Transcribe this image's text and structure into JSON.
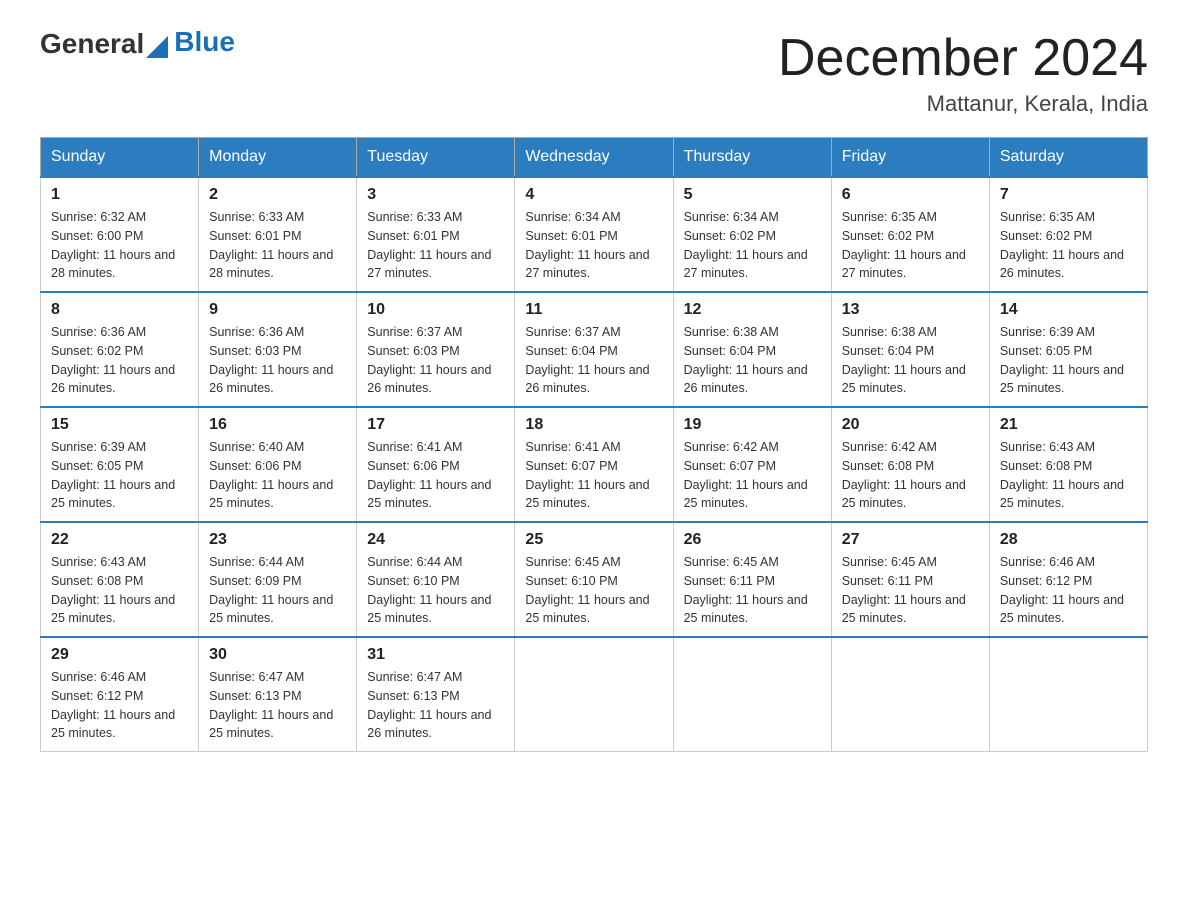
{
  "header": {
    "logo": {
      "general": "General",
      "blue": "Blue"
    },
    "title": "December 2024",
    "location": "Mattanur, Kerala, India"
  },
  "days_of_week": [
    "Sunday",
    "Monday",
    "Tuesday",
    "Wednesday",
    "Thursday",
    "Friday",
    "Saturday"
  ],
  "weeks": [
    [
      {
        "day": "1",
        "sunrise": "6:32 AM",
        "sunset": "6:00 PM",
        "daylight": "11 hours and 28 minutes."
      },
      {
        "day": "2",
        "sunrise": "6:33 AM",
        "sunset": "6:01 PM",
        "daylight": "11 hours and 28 minutes."
      },
      {
        "day": "3",
        "sunrise": "6:33 AM",
        "sunset": "6:01 PM",
        "daylight": "11 hours and 27 minutes."
      },
      {
        "day": "4",
        "sunrise": "6:34 AM",
        "sunset": "6:01 PM",
        "daylight": "11 hours and 27 minutes."
      },
      {
        "day": "5",
        "sunrise": "6:34 AM",
        "sunset": "6:02 PM",
        "daylight": "11 hours and 27 minutes."
      },
      {
        "day": "6",
        "sunrise": "6:35 AM",
        "sunset": "6:02 PM",
        "daylight": "11 hours and 27 minutes."
      },
      {
        "day": "7",
        "sunrise": "6:35 AM",
        "sunset": "6:02 PM",
        "daylight": "11 hours and 26 minutes."
      }
    ],
    [
      {
        "day": "8",
        "sunrise": "6:36 AM",
        "sunset": "6:02 PM",
        "daylight": "11 hours and 26 minutes."
      },
      {
        "day": "9",
        "sunrise": "6:36 AM",
        "sunset": "6:03 PM",
        "daylight": "11 hours and 26 minutes."
      },
      {
        "day": "10",
        "sunrise": "6:37 AM",
        "sunset": "6:03 PM",
        "daylight": "11 hours and 26 minutes."
      },
      {
        "day": "11",
        "sunrise": "6:37 AM",
        "sunset": "6:04 PM",
        "daylight": "11 hours and 26 minutes."
      },
      {
        "day": "12",
        "sunrise": "6:38 AM",
        "sunset": "6:04 PM",
        "daylight": "11 hours and 26 minutes."
      },
      {
        "day": "13",
        "sunrise": "6:38 AM",
        "sunset": "6:04 PM",
        "daylight": "11 hours and 25 minutes."
      },
      {
        "day": "14",
        "sunrise": "6:39 AM",
        "sunset": "6:05 PM",
        "daylight": "11 hours and 25 minutes."
      }
    ],
    [
      {
        "day": "15",
        "sunrise": "6:39 AM",
        "sunset": "6:05 PM",
        "daylight": "11 hours and 25 minutes."
      },
      {
        "day": "16",
        "sunrise": "6:40 AM",
        "sunset": "6:06 PM",
        "daylight": "11 hours and 25 minutes."
      },
      {
        "day": "17",
        "sunrise": "6:41 AM",
        "sunset": "6:06 PM",
        "daylight": "11 hours and 25 minutes."
      },
      {
        "day": "18",
        "sunrise": "6:41 AM",
        "sunset": "6:07 PM",
        "daylight": "11 hours and 25 minutes."
      },
      {
        "day": "19",
        "sunrise": "6:42 AM",
        "sunset": "6:07 PM",
        "daylight": "11 hours and 25 minutes."
      },
      {
        "day": "20",
        "sunrise": "6:42 AM",
        "sunset": "6:08 PM",
        "daylight": "11 hours and 25 minutes."
      },
      {
        "day": "21",
        "sunrise": "6:43 AM",
        "sunset": "6:08 PM",
        "daylight": "11 hours and 25 minutes."
      }
    ],
    [
      {
        "day": "22",
        "sunrise": "6:43 AM",
        "sunset": "6:08 PM",
        "daylight": "11 hours and 25 minutes."
      },
      {
        "day": "23",
        "sunrise": "6:44 AM",
        "sunset": "6:09 PM",
        "daylight": "11 hours and 25 minutes."
      },
      {
        "day": "24",
        "sunrise": "6:44 AM",
        "sunset": "6:10 PM",
        "daylight": "11 hours and 25 minutes."
      },
      {
        "day": "25",
        "sunrise": "6:45 AM",
        "sunset": "6:10 PM",
        "daylight": "11 hours and 25 minutes."
      },
      {
        "day": "26",
        "sunrise": "6:45 AM",
        "sunset": "6:11 PM",
        "daylight": "11 hours and 25 minutes."
      },
      {
        "day": "27",
        "sunrise": "6:45 AM",
        "sunset": "6:11 PM",
        "daylight": "11 hours and 25 minutes."
      },
      {
        "day": "28",
        "sunrise": "6:46 AM",
        "sunset": "6:12 PM",
        "daylight": "11 hours and 25 minutes."
      }
    ],
    [
      {
        "day": "29",
        "sunrise": "6:46 AM",
        "sunset": "6:12 PM",
        "daylight": "11 hours and 25 minutes."
      },
      {
        "day": "30",
        "sunrise": "6:47 AM",
        "sunset": "6:13 PM",
        "daylight": "11 hours and 25 minutes."
      },
      {
        "day": "31",
        "sunrise": "6:47 AM",
        "sunset": "6:13 PM",
        "daylight": "11 hours and 26 minutes."
      },
      null,
      null,
      null,
      null
    ]
  ]
}
